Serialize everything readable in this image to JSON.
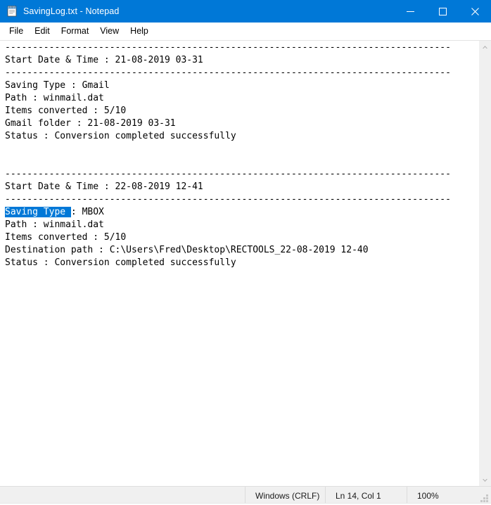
{
  "window": {
    "title": "SavingLog.txt - Notepad",
    "icon": "notepad-icon",
    "accent_color": "#0078d7",
    "caption": {
      "minimize": "minimize",
      "maximize": "maximize",
      "close": "close"
    }
  },
  "menubar": {
    "items": [
      {
        "label": "File"
      },
      {
        "label": "Edit"
      },
      {
        "label": "Format"
      },
      {
        "label": "View"
      },
      {
        "label": "Help"
      }
    ]
  },
  "document": {
    "selection": {
      "text": "Saving Type ",
      "line_index": 13,
      "color": "#0078d7"
    },
    "lines": [
      "---------------------------------------------------------------------------------",
      "Start Date & Time : 21-08-2019 03-31",
      "---------------------------------------------------------------------------------",
      "Saving Type : Gmail",
      "Path : winmail.dat",
      "Items converted : 5/10",
      "Gmail folder : 21-08-2019 03-31",
      "Status : Conversion completed successfully",
      "",
      "",
      "---------------------------------------------------------------------------------",
      "Start Date & Time : 22-08-2019 12-41",
      "---------------------------------------------------------------------------------",
      "Saving Type : MBOX",
      "Path : winmail.dat",
      "Items converted : 5/10",
      "Destination path : C:\\Users\\Fred\\Desktop\\RECTOOLS_22-08-2019 12-40",
      "Status : Conversion completed successfully"
    ]
  },
  "scrollbar": {
    "up_arrow": "chevron-up-icon",
    "down_arrow": "chevron-down-icon"
  },
  "statusbar": {
    "encoding": "Windows (CRLF)",
    "position": "Ln 14, Col 1",
    "zoom": "100%"
  }
}
